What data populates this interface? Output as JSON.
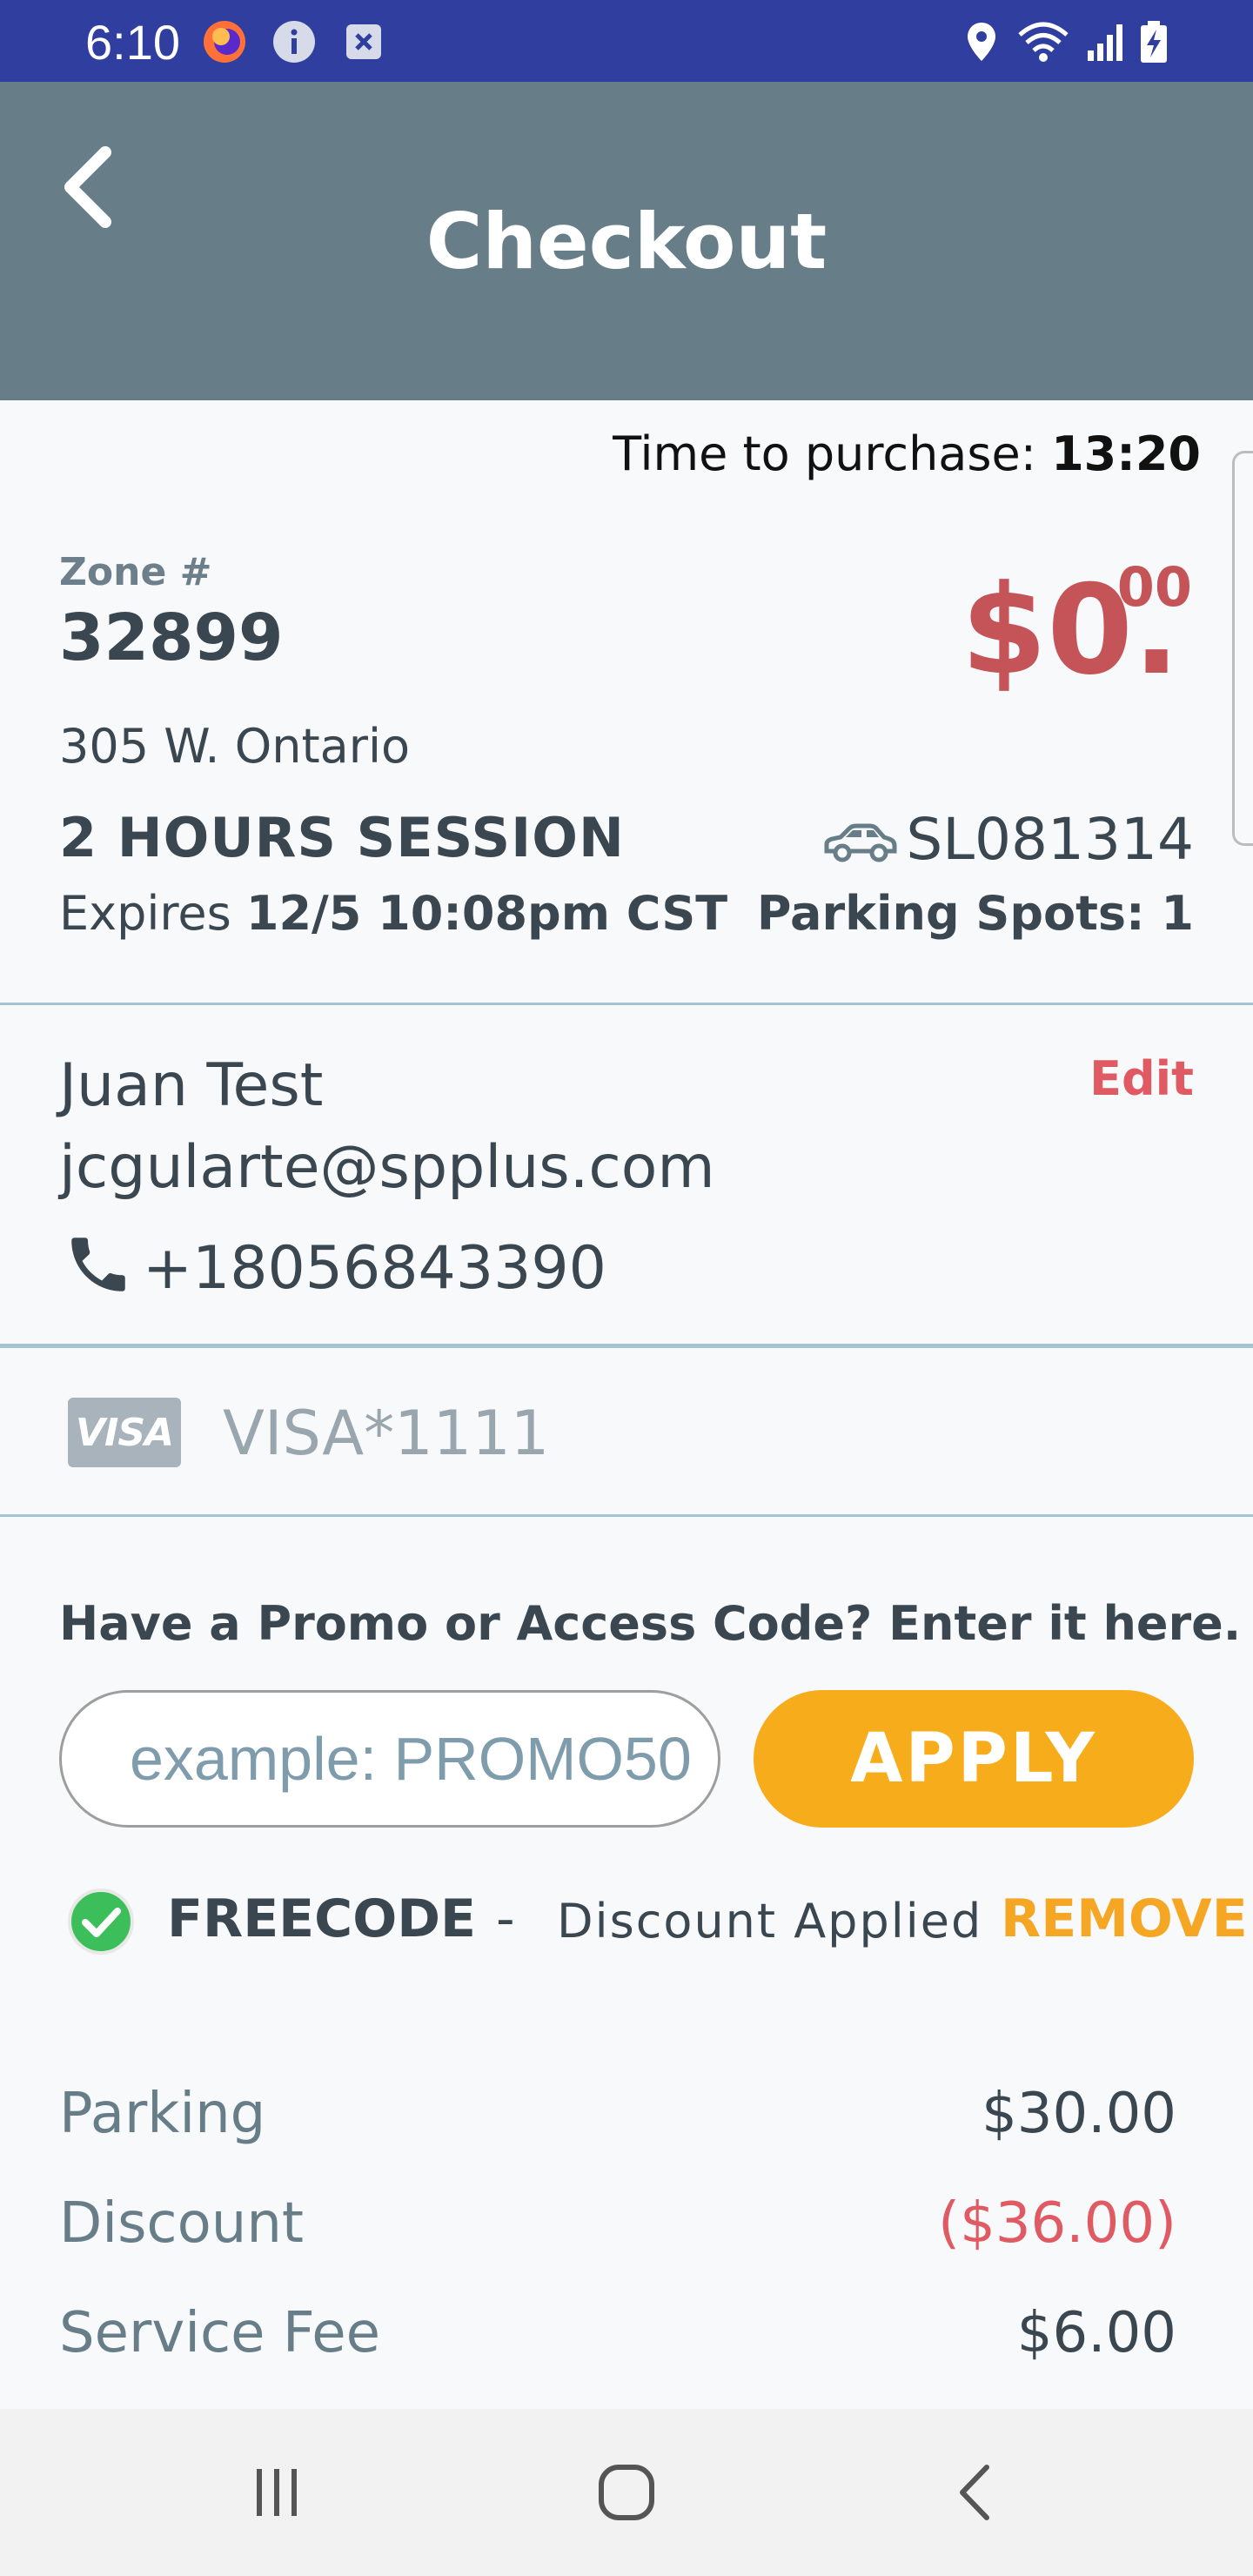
{
  "status_bar": {
    "time": "6:10",
    "icons_left": [
      "firefox-icon",
      "info-icon",
      "close-box-icon"
    ],
    "icons_right": [
      "location-icon",
      "wifi-icon",
      "signal-icon",
      "battery-icon"
    ]
  },
  "app_bar": {
    "title": "Checkout"
  },
  "timer": {
    "label": "Time to purchase: ",
    "value": "13:20"
  },
  "zone": {
    "label": "Zone #",
    "number": "32899",
    "address": "305 W. Ontario"
  },
  "price": {
    "dollars": "$0.",
    "cents": "00"
  },
  "session": {
    "title": "2 HOURS  SESSION",
    "expires_label": "Expires ",
    "expires_value": "12/5 10:08pm CST"
  },
  "vehicle": {
    "plate": "SL081314",
    "spots": "Parking Spots: 1"
  },
  "contact": {
    "name": "Juan Test",
    "email": "jcgularte@spplus.com",
    "phone": "+18056843390",
    "edit_label": "Edit"
  },
  "payment": {
    "brand": "VISA",
    "card": "VISA*1111"
  },
  "promo": {
    "label": "Have a Promo or Access Code? Enter it here.",
    "placeholder": "example: PROMO50",
    "apply_label": "APPLY",
    "applied_code": "FREECODE",
    "dash": "-",
    "applied_status": "Discount Applied",
    "remove_label": "REMOVE"
  },
  "summary": [
    {
      "label": "Parking",
      "value": "$30.00"
    },
    {
      "label": "Discount",
      "value": "($36.00)"
    },
    {
      "label": "Service Fee",
      "value": "$6.00"
    }
  ],
  "colors": {
    "status_bar": "#303f9f",
    "app_bar": "#677e89",
    "price": "#c55458",
    "accent_orange": "#f7ac1b",
    "edit_red": "#e05a63",
    "divider": "#a6c3d1"
  }
}
